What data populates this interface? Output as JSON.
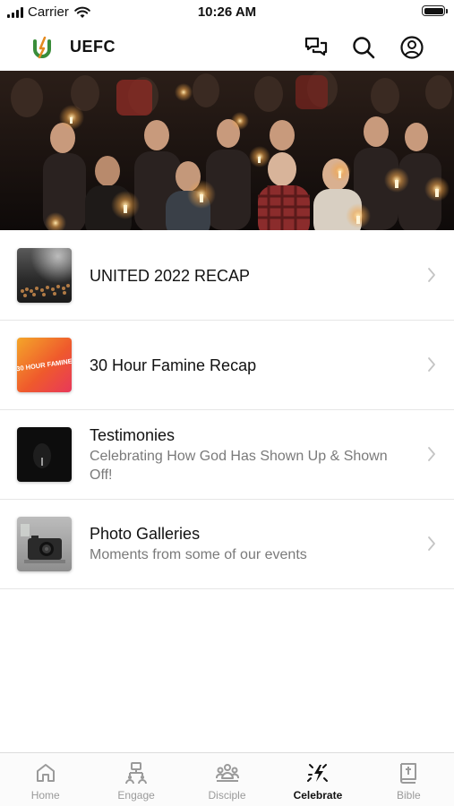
{
  "status_bar": {
    "carrier": "Carrier",
    "time": "10:26 AM"
  },
  "header": {
    "title": "UEFC",
    "icons": [
      "chat-icon",
      "search-icon",
      "profile-icon"
    ]
  },
  "hero": {
    "icon": "candlelight-congregation-photo"
  },
  "list": [
    {
      "title": "UNITED 2022 RECAP",
      "subtitle": "",
      "thumb": "crowd-photo"
    },
    {
      "title": "30 Hour Famine Recap",
      "subtitle": "",
      "thumb": "famine-graphic",
      "thumb_text": "30 HOUR FAMINE"
    },
    {
      "title": "Testimonies",
      "subtitle": "Celebrating How God Has Shown Up & Shown Off!",
      "thumb": "dark-figure-photo"
    },
    {
      "title": "Photo Galleries",
      "subtitle": "Moments from some of our events",
      "thumb": "camera-photo"
    }
  ],
  "tabs": [
    {
      "label": "Home",
      "icon": "home-icon",
      "active": false
    },
    {
      "label": "Engage",
      "icon": "engage-icon",
      "active": false
    },
    {
      "label": "Disciple",
      "icon": "disciple-icon",
      "active": false
    },
    {
      "label": "Celebrate",
      "icon": "celebrate-icon",
      "active": true
    },
    {
      "label": "Bible",
      "icon": "bible-icon",
      "active": false
    }
  ],
  "colors": {
    "logo_green": "#3a8d3a",
    "logo_orange": "#e58a1f",
    "active_tab": "#111111",
    "inactive_tab": "#9a9a9a"
  }
}
